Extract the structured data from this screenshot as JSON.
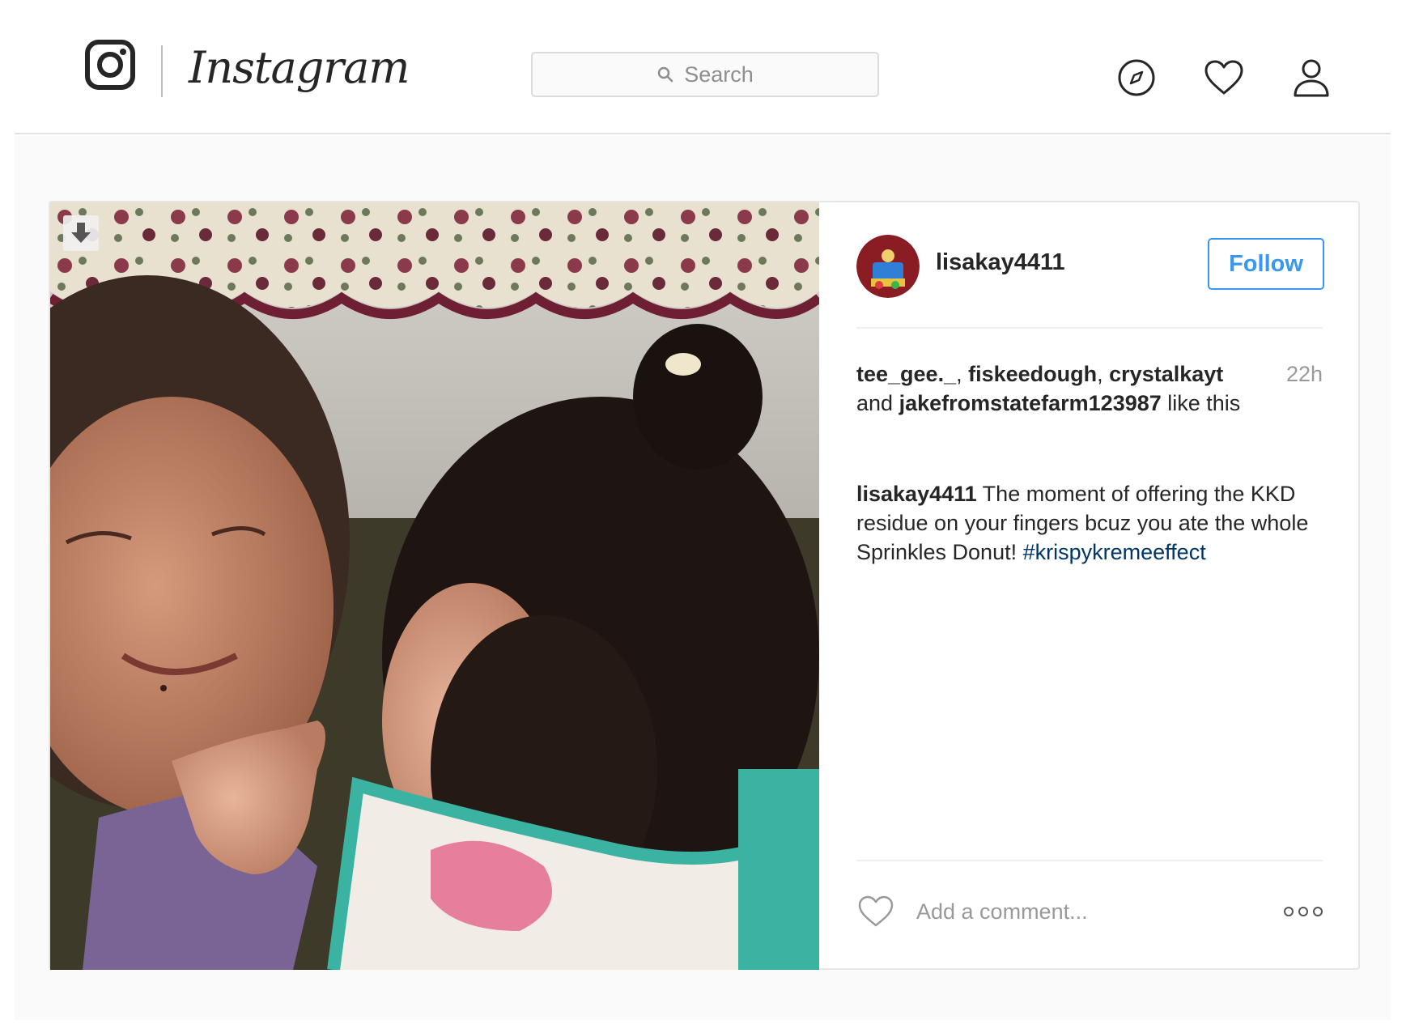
{
  "header": {
    "logo_text": "Instagram",
    "search_placeholder": "Search"
  },
  "post": {
    "author": "lisakay4411",
    "follow_label": "Follow",
    "likes": {
      "user1": "tee_gee._",
      "sep1": ", ",
      "user2": "fiskeedough",
      "sep2": ", ",
      "user3": "crystalkayt",
      "and": " and ",
      "user4": "jakefromstatefarm123987",
      "suffix": " like this"
    },
    "time": "22h",
    "caption": {
      "author": "lisakay4411",
      "text": " The moment of offering the KKD residue on your fingers bcuz you ate the whole Sprinkles Donut! ",
      "hashtag": "#krispykremeeffect"
    },
    "comment_placeholder": "Add a comment..."
  },
  "icons": [
    "instagram-camera-icon",
    "search-icon",
    "compass-icon",
    "heart-icon",
    "person-icon",
    "download-icon",
    "like-heart-icon",
    "more-dots-icon"
  ],
  "colors": {
    "link_blue": "#3897f0",
    "hashtag": "#003569",
    "muted": "#999999"
  }
}
